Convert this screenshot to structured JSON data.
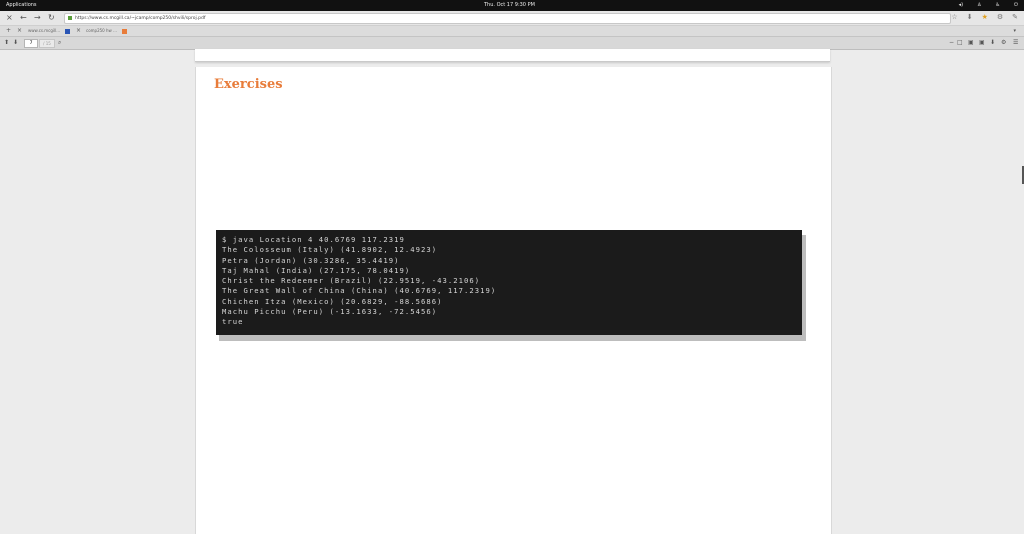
{
  "system_bar": {
    "applications_label": "Applications",
    "clock": "Thu. Oct 17     9:30 PM"
  },
  "browser": {
    "url": "https://www.cs.mcgill.ca/~jcamp/comp250/shvili/sproj.pdf",
    "tabs": [
      {
        "label": "www.cs.mcgill...",
        "active": true
      },
      {
        "label": "comp250 hw ...",
        "active": false
      }
    ]
  },
  "pdf_toolbar": {
    "page_number": "7",
    "page_count": "/ 15"
  },
  "document": {
    "heading": "Exercises",
    "heading_color": "#e87c3a",
    "terminal_lines": [
      "$ java Location 4 40.6769 117.2319",
      "The Colosseum (Italy) (41.8902, 12.4923)",
      "Petra (Jordan) (30.3286, 35.4419)",
      "Taj Mahal (India) (27.175, 78.0419)",
      "Christ the Redeemer (Brazil) (22.9519, -43.2106)",
      "The Great Wall of China (China) (40.6769, 117.2319)",
      "Chichen Itza (Mexico) (20.6829, -88.5686)",
      "Machu Picchu (Peru) (-13.1633, -72.5456)",
      "true"
    ]
  }
}
